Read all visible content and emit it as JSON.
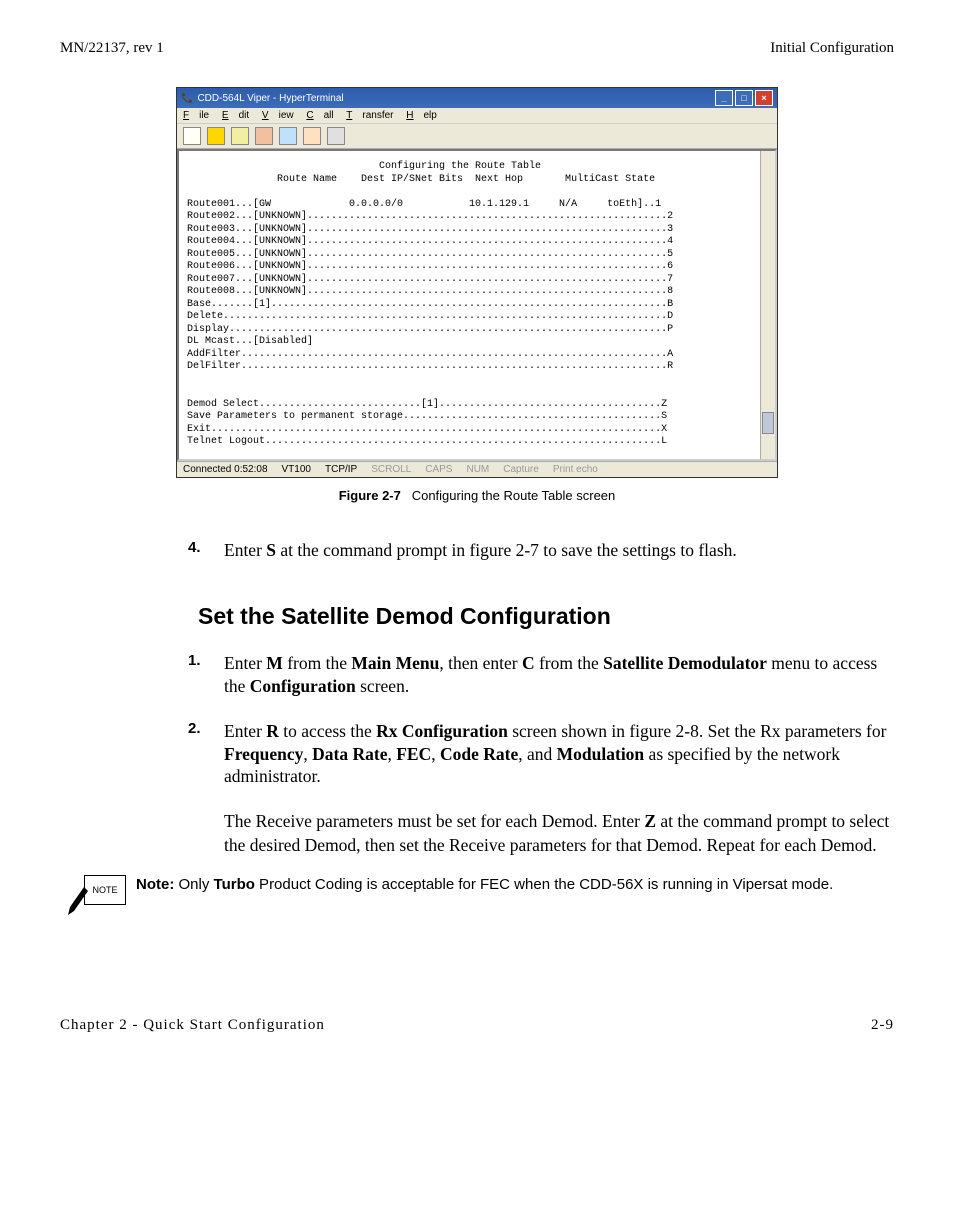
{
  "header": {
    "left": "MN/22137, rev 1",
    "right": "Initial Configuration"
  },
  "terminal": {
    "title": "CDD-564L Viper - HyperTerminal",
    "menus": {
      "file": "File",
      "edit": "Edit",
      "view": "View",
      "call": "Call",
      "transfer": "Transfer",
      "help": "Help"
    },
    "content": "                                Configuring the Route Table\n               Route Name    Dest IP/SNet Bits  Next Hop       MultiCast State\n\nRoute001...[GW             0.0.0.0/0           10.1.129.1     N/A     toEth]..1\nRoute002...[UNKNOWN]............................................................2\nRoute003...[UNKNOWN]............................................................3\nRoute004...[UNKNOWN]............................................................4\nRoute005...[UNKNOWN]............................................................5\nRoute006...[UNKNOWN]............................................................6\nRoute007...[UNKNOWN]............................................................7\nRoute008...[UNKNOWN]............................................................8\nBase.......[1]..................................................................B\nDelete..........................................................................D\nDisplay.........................................................................P\nDL Mcast...[Disabled]\nAddFilter.......................................................................A\nDelFilter.......................................................................R\n\n\nDemod Select...........................[1].....................................Z\nSave Parameters to permanent storage...........................................S\nExit...........................................................................X\nTelnet Logout..................................................................L\n",
    "status": {
      "connected": "Connected 0:52:08",
      "emulation": "VT100",
      "protocol": "TCP/IP",
      "scr": "SCROLL",
      "caps": "CAPS",
      "num": "NUM",
      "capture": "Capture",
      "echo": "Print echo"
    }
  },
  "caption": {
    "label": "Figure 2-7",
    "text": "Configuring the Route Table screen"
  },
  "step4": {
    "num": "4.",
    "pre": "Enter ",
    "s": "S",
    "post": " at the command prompt in figure 2-7 to save the settings to flash."
  },
  "heading2": "Set the Satellite Demod Configuration",
  "step1": {
    "num": "1.",
    "t1": "Enter ",
    "m": "M",
    "t2": " from the ",
    "mainmenu": "Main Menu",
    "t3": ", then enter ",
    "c": "C",
    "t4": " from the ",
    "sat1": "Satellite",
    "sat2": "Demodulator",
    "t5": " menu to access the ",
    "conf": "Configuration",
    "t6": " screen."
  },
  "step2": {
    "num": "2.",
    "t1": "Enter ",
    "r": "R",
    "t2": " to access the ",
    "rxconf": "Rx Configuration",
    "t3": " screen shown in figure 2-8. Set the Rx parameters for ",
    "freq": "Frequency",
    "c1": ", ",
    "dr": "Data Rate",
    "c2": ", ",
    "fec": "FEC",
    "c3": ", ",
    "cr": "Code Rate",
    "c4": ", and ",
    "mod": "Modulation",
    "t4": " as specified by the network administrator."
  },
  "para": {
    "t1": "The Receive parameters must be set for each Demod. Enter ",
    "z": "Z",
    "t2": " at the command prompt to select the desired Demod, then set the Receive parameters for that Demod. Repeat for each Demod."
  },
  "note": {
    "icon_label": "NOTE",
    "prefix": "Note:",
    "t1": "  Only ",
    "turbo": "Turbo",
    "t2": " Product Coding is acceptable for FEC when the CDD-56X is running in Vipersat mode."
  },
  "footer": {
    "left": "Chapter 2 - Quick Start Configuration",
    "right": "2-9"
  }
}
